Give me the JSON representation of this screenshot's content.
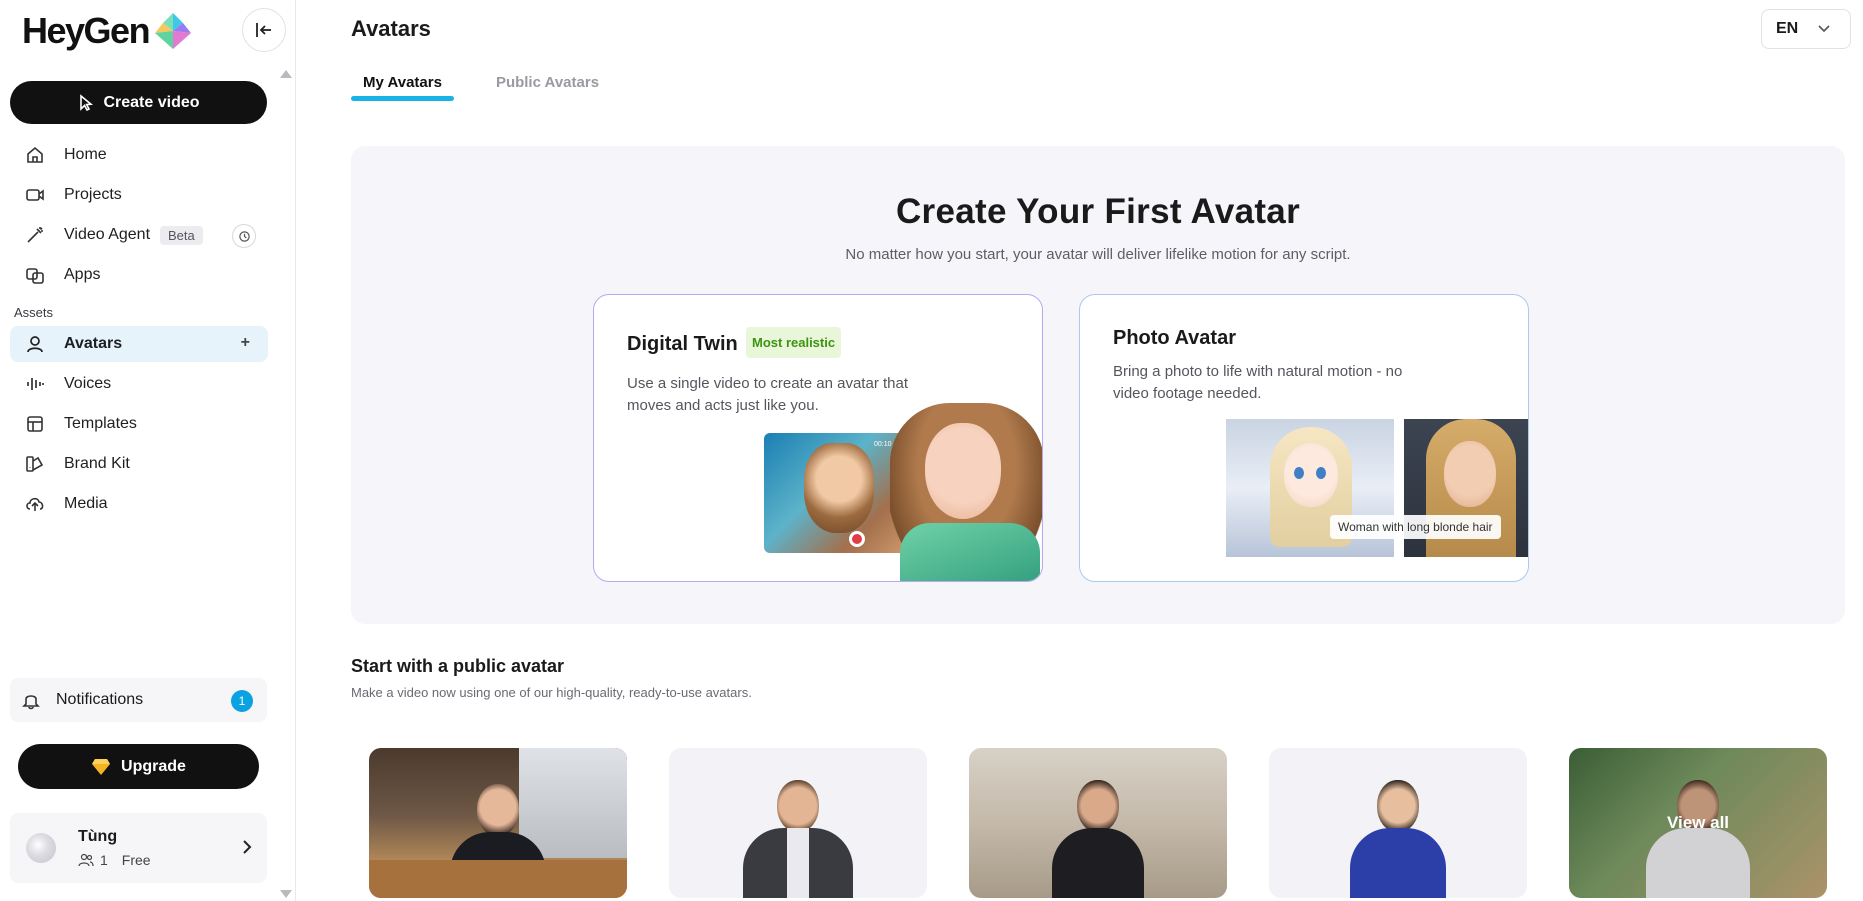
{
  "app": {
    "logo_text": "HeyGen",
    "create_video_label": "Create video"
  },
  "sidebar": {
    "nav": [
      {
        "label": "Home",
        "icon": "home-icon"
      },
      {
        "label": "Projects",
        "icon": "video-camera-icon"
      },
      {
        "label": "Video Agent",
        "icon": "magic-wand-icon",
        "badge": "Beta"
      },
      {
        "label": "Apps",
        "icon": "apps-icon"
      }
    ],
    "assets_label": "Assets",
    "assets": [
      {
        "label": "Avatars",
        "icon": "user-icon",
        "active": true
      },
      {
        "label": "Voices",
        "icon": "waveform-icon"
      },
      {
        "label": "Templates",
        "icon": "template-icon"
      },
      {
        "label": "Brand Kit",
        "icon": "brand-kit-icon"
      },
      {
        "label": "Media",
        "icon": "cloud-upload-icon"
      }
    ],
    "notifications": {
      "label": "Notifications",
      "count": "1"
    },
    "upgrade_label": "Upgrade",
    "user": {
      "name": "Tùng",
      "members": "1",
      "plan": "Free"
    }
  },
  "header": {
    "title": "Avatars",
    "language": "EN"
  },
  "tabs": [
    {
      "label": "My Avatars",
      "active": true
    },
    {
      "label": "Public Avatars",
      "active": false
    }
  ],
  "hero": {
    "title": "Create Your First Avatar",
    "subtitle": "No matter how you start, your avatar will deliver lifelike motion for any script.",
    "digital_twin": {
      "title": "Digital Twin",
      "badge": "Most realistic",
      "description": "Use a single video to create an avatar that moves and acts just like you.",
      "timer": "00:10 / 3:00"
    },
    "photo_avatar": {
      "title": "Photo Avatar",
      "description": "Bring a photo to life with natural motion - no video footage needed.",
      "caption": "Woman with long blonde hair"
    }
  },
  "public_section": {
    "title": "Start with a public avatar",
    "subtitle": "Make a video now using one of our high-quality, ready-to-use avatars.",
    "view_all_label": "View all"
  },
  "colors": {
    "accent": "#19b3e6",
    "active_nav_bg": "#e6f3fb",
    "badge_green": "#3d9412",
    "notif_badge": "#0aa2e0"
  }
}
